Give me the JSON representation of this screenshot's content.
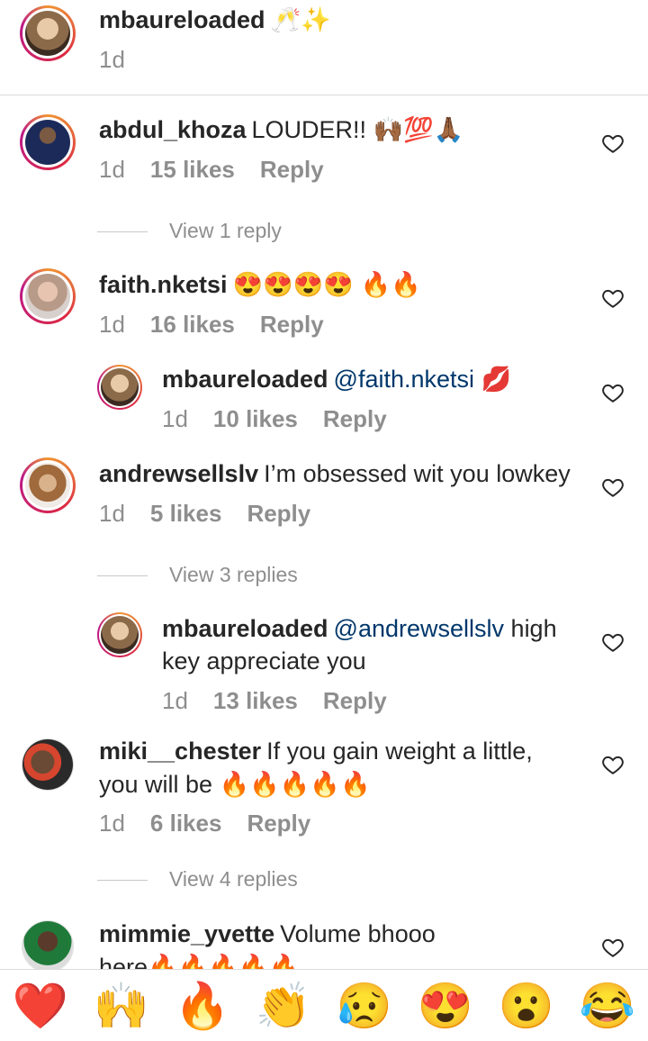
{
  "caption": {
    "username": "mbaureloaded",
    "text": "🥂✨",
    "time": "1d"
  },
  "comments": [
    {
      "username": "abdul_khoza",
      "text": "LOUDER!! 🙌🏾💯🙏🏾",
      "time": "1d",
      "likes": "15 likes",
      "reply": "Reply",
      "view_replies": "View 1 reply"
    },
    {
      "username": "faith.nketsi",
      "text": "😍😍😍😍 🔥🔥",
      "time": "1d",
      "likes": "16 likes",
      "reply": "Reply"
    },
    {
      "username": "mbaureloaded",
      "mention": "@faith.nketsi",
      "text": "💋",
      "time": "1d",
      "likes": "10 likes",
      "reply": "Reply"
    },
    {
      "username": "andrewsellslv",
      "text": "I’m obsessed wit you lowkey",
      "time": "1d",
      "likes": "5 likes",
      "reply": "Reply",
      "view_replies": "View 3 replies"
    },
    {
      "username": "mbaureloaded",
      "mention": "@andrewsellslv",
      "text": "high",
      "text2": "key appreciate you",
      "time": "1d",
      "likes": "13 likes",
      "reply": "Reply"
    },
    {
      "username": "miki__chester",
      "text": "If you gain weight a little,",
      "text2": "you will be 🔥🔥🔥🔥🔥",
      "time": "1d",
      "likes": "6 likes",
      "reply": "Reply",
      "view_replies": "View 4 replies"
    },
    {
      "username": "mimmie_yvette",
      "text": "Volume bhooo",
      "text2": "here🔥🔥🔥🔥🔥"
    }
  ],
  "reactions": [
    "❤️",
    "🙌",
    "🔥",
    "👏",
    "😥",
    "😍",
    "😮",
    "😂"
  ],
  "colors": {
    "ring_start": "#f09433",
    "ring_end": "#bc1888",
    "muted": "#8e8e8e",
    "mention": "#00376b"
  }
}
